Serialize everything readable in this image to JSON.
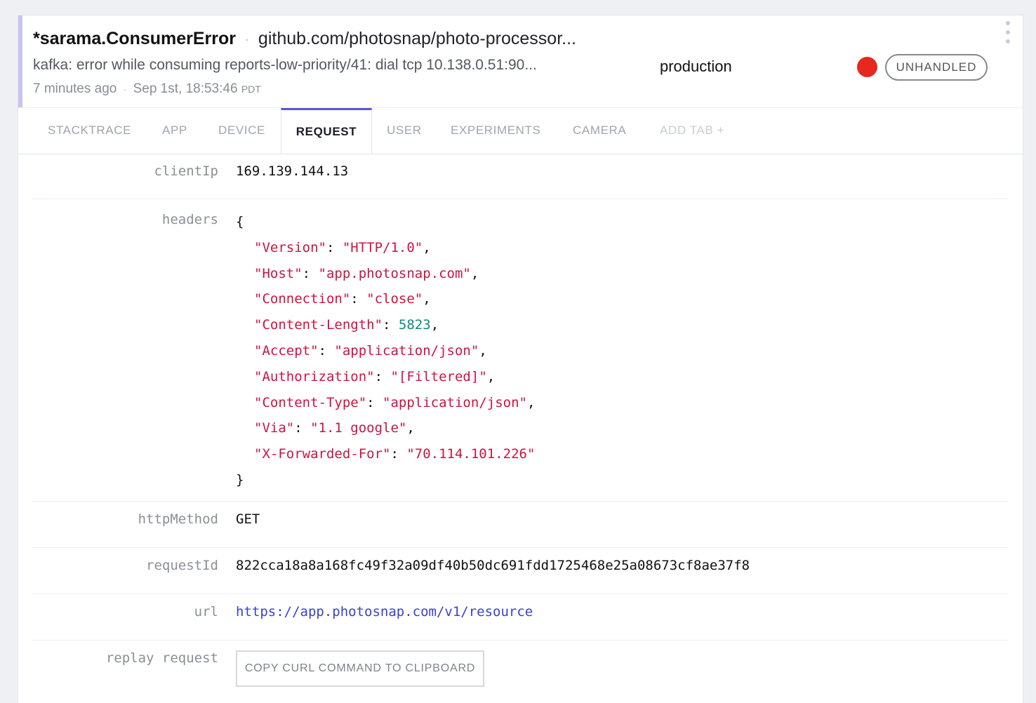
{
  "header": {
    "error_type": "*sarama.ConsumerError",
    "separator": "·",
    "error_location": "github.com/photosnap/photo-processor...",
    "message": "kafka: error while consuming reports-low-priority/41: dial tcp 10.138.0.51:90...",
    "environment": "production",
    "relative_time": "7 minutes ago",
    "absolute_time": "Sep 1st, 18:53:46",
    "timezone": "PDT",
    "severity_color": "#e6281e",
    "badge": "UNHANDLED"
  },
  "tabs": [
    {
      "label": "STACKTRACE",
      "active": false
    },
    {
      "label": "APP",
      "active": false
    },
    {
      "label": "DEVICE",
      "active": false
    },
    {
      "label": "REQUEST",
      "active": true
    },
    {
      "label": "USER",
      "active": false
    },
    {
      "label": "EXPERIMENTS",
      "active": false
    },
    {
      "label": "CAMERA",
      "active": false
    },
    {
      "label": "ADD TAB +",
      "active": false
    }
  ],
  "request": {
    "clientIp": {
      "key": "clientIp",
      "value": "169.139.144.13"
    },
    "headers": {
      "key": "headers",
      "open": "{",
      "close": "}",
      "entries": [
        {
          "k": "\"Version\"",
          "v": "\"HTTP/1.0\"",
          "type": "string",
          "trail": ","
        },
        {
          "k": "\"Host\"",
          "v": "\"app.photosnap.com\"",
          "type": "string",
          "trail": ","
        },
        {
          "k": "\"Connection\"",
          "v": "\"close\"",
          "type": "string",
          "trail": ","
        },
        {
          "k": "\"Content-Length\"",
          "v": "5823",
          "type": "number",
          "trail": ","
        },
        {
          "k": "\"Accept\"",
          "v": "\"application/json\"",
          "type": "string",
          "trail": ","
        },
        {
          "k": "\"Authorization\"",
          "v": "\"[Filtered]\"",
          "type": "string",
          "trail": ","
        },
        {
          "k": "\"Content-Type\"",
          "v": "\"application/json\"",
          "type": "string",
          "trail": ","
        },
        {
          "k": "\"Via\"",
          "v": "\"1.1 google\"",
          "type": "string",
          "trail": ","
        },
        {
          "k": "\"X-Forwarded-For\"",
          "v": "\"70.114.101.226\"",
          "type": "string",
          "trail": ""
        }
      ]
    },
    "httpMethod": {
      "key": "httpMethod",
      "value": "GET"
    },
    "requestId": {
      "key": "requestId",
      "value": "822cca18a8a168fc49f32a09df40b50dc691fdd1725468e25a08673cf8ae37f8"
    },
    "url": {
      "key": "url",
      "value": "https://app.photosnap.com/v1/resource"
    },
    "replay": {
      "key": "replay request",
      "button": "COPY CURL COMMAND TO CLIPBOARD"
    }
  },
  "colors": {
    "accent": "#5b53d6",
    "json_string": "#d0123f",
    "json_number": "#0f8a80",
    "link": "#3a3fd6"
  }
}
